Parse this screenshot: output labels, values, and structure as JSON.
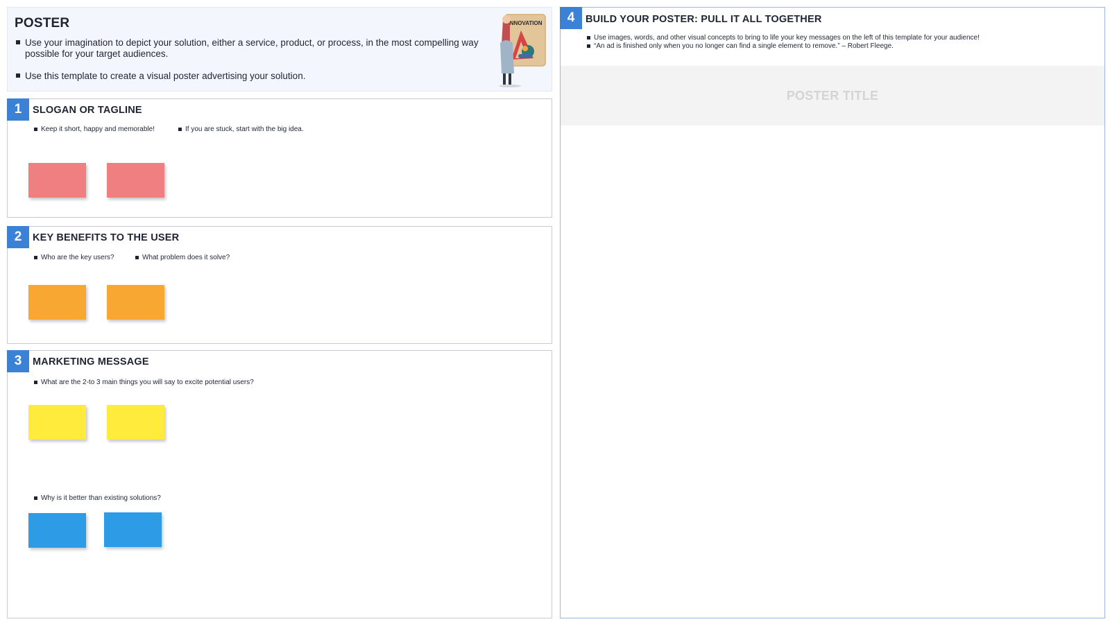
{
  "intro": {
    "title": "POSTER",
    "bullets": [
      "Use your imagination to depict your solution, either a service, product, or process, in the most compelling way possible for your target audiences.",
      "Use this template to create a visual poster advertising your solution."
    ],
    "illustration": {
      "icon": "person-holding-innovation-poster-icon",
      "sign_text": "INNOVATION"
    }
  },
  "sections": [
    {
      "number": "1",
      "title": "SLOGAN OR TAGLINE",
      "bullets": [
        "Keep it short, happy and memorable!",
        "If you are stuck, start with the big idea."
      ],
      "note_color": "#f07f82"
    },
    {
      "number": "2",
      "title": "KEY BENEFITS TO THE USER",
      "bullets": [
        "Who are the key users?",
        "What problem does it solve?"
      ],
      "note_color": "#f8a733"
    },
    {
      "number": "3",
      "title": "MARKETING MESSAGE",
      "bullets": [
        "What are the 2-to 3 main things you will say to excite potential users?",
        "Why is it better than existing solutions?"
      ],
      "note_colors": [
        "#ffeb3b",
        "#2e9be6"
      ]
    },
    {
      "number": "4",
      "title": "BUILD YOUR POSTER: PULL IT ALL TOGETHER",
      "bullets": [
        "Use images, words, and other visual concepts to bring to life your key messages on the left of this template for your audience!",
        "“An ad is finished only when you no longer can find a single element to remove.” – Robert Fleege."
      ],
      "poster_title": "POSTER TITLE"
    }
  ],
  "colors": {
    "accent": "#3b82d6",
    "intro_bg": "#f3f6fc"
  }
}
